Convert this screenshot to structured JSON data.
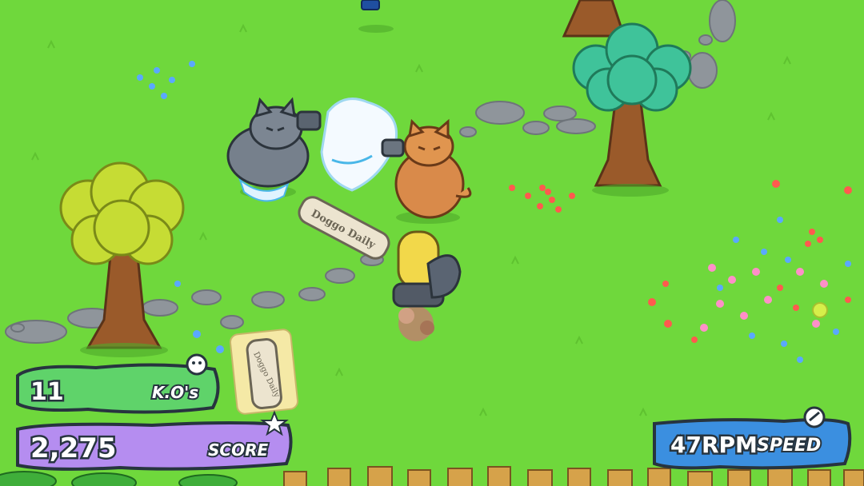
{
  "hud": {
    "kos": {
      "value": "11",
      "label": "K.O's"
    },
    "score": {
      "value": "2,275",
      "label": "SCORE"
    },
    "speed": {
      "value": "47RPM",
      "label": "SPEED"
    }
  },
  "props": {
    "newspaper_text": "Doggo Daily",
    "pickup_text": "Doggo Daily"
  },
  "colors": {
    "grass": "#6fd83c",
    "kos_panel": "#5fd36a",
    "score_panel": "#b58df0",
    "speed_panel": "#3b8fe0",
    "outline": "#27343f"
  },
  "icons": [
    "paw-icon",
    "dog-head-icon",
    "star-paw-icon",
    "wrench-icon"
  ]
}
